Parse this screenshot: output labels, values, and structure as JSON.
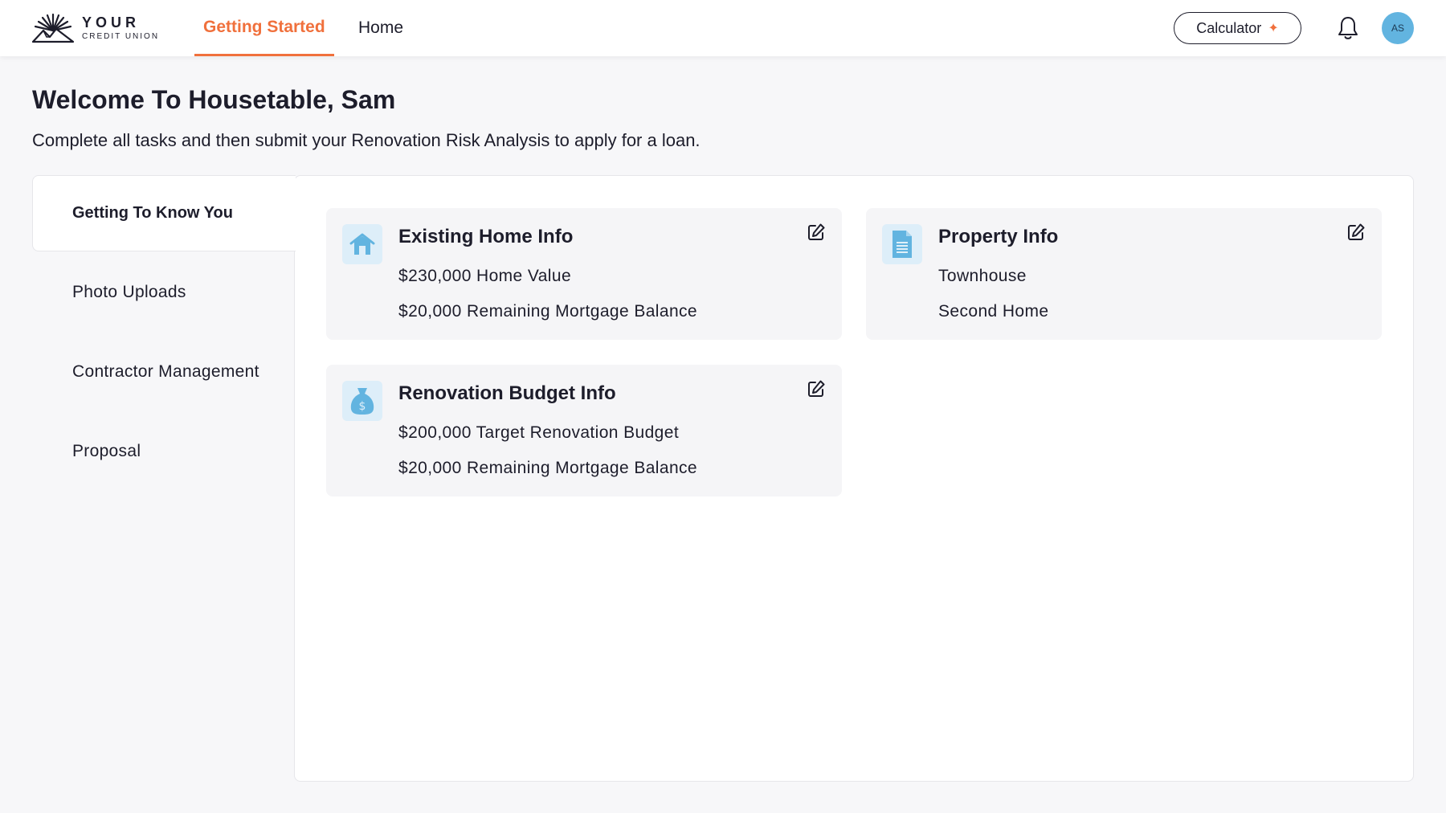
{
  "brand": {
    "top": "YOUR",
    "bottom": "CREDIT UNION"
  },
  "nav": {
    "tabs": [
      {
        "label": "Getting Started"
      },
      {
        "label": "Home"
      }
    ]
  },
  "header": {
    "calculator_label": "Calculator",
    "avatar_initials": "AS"
  },
  "page": {
    "title": "Welcome To Housetable, Sam",
    "subtitle": "Complete all tasks and then submit your Renovation Risk Analysis to apply for a loan."
  },
  "sidebar": {
    "items": [
      {
        "label": "Getting To Know You"
      },
      {
        "label": "Photo Uploads"
      },
      {
        "label": "Contractor Management"
      },
      {
        "label": "Proposal"
      }
    ]
  },
  "cards": [
    {
      "title": "Existing Home Info",
      "lines": [
        "$230,000 Home Value",
        "$20,000 Remaining Mortgage Balance"
      ],
      "icon": "house-icon"
    },
    {
      "title": "Property Info",
      "lines": [
        "Townhouse",
        "Second Home"
      ],
      "icon": "document-icon"
    },
    {
      "title": "Renovation Budget Info",
      "lines": [
        "$200,000 Target Renovation Budget",
        "$20,000 Remaining Mortgage Balance"
      ],
      "icon": "money-bag-icon"
    }
  ],
  "colors": {
    "accent": "#f0703c",
    "icon_blue": "#62b4e0",
    "icon_bg": "#ddeef9",
    "card_bg": "#f5f5f7"
  }
}
